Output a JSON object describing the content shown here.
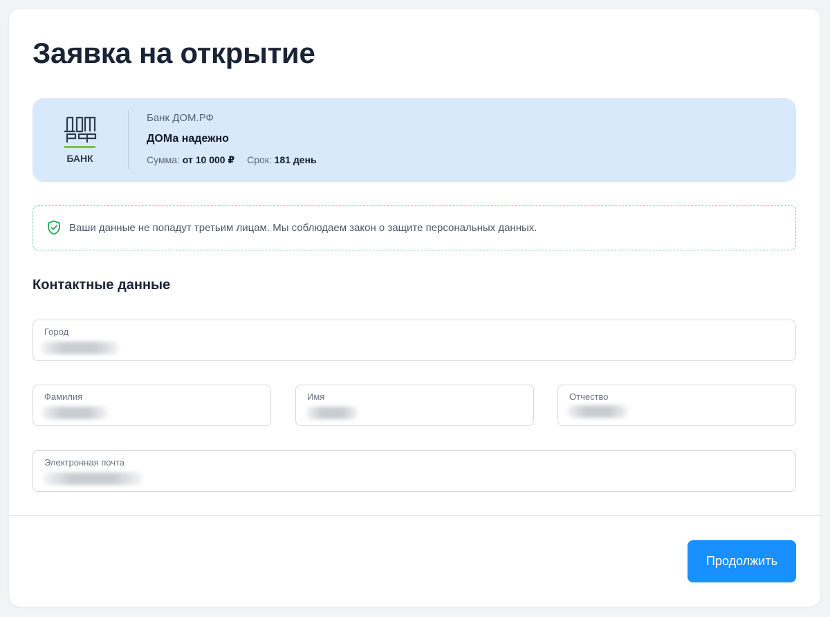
{
  "page": {
    "title": "Заявка на открытие"
  },
  "bank": {
    "logo_text": "БАНК",
    "name": "Банк ДОМ.РФ",
    "product": "ДОМа надежно",
    "amount_label": "Сумма:",
    "amount_value": "от 10 000 ₽",
    "term_label": "Срок:",
    "term_value": "181 день",
    "colors": {
      "panel": "#d8e9fb",
      "logo": "#2f3a4a",
      "logo_accent": "#7cc242"
    }
  },
  "privacy": {
    "icon": "shield-check-icon",
    "text": "Ваши данные не попадут третьим лицам. Мы соблюдаем закон о защите персональных данных."
  },
  "contacts": {
    "title": "Контактные данные",
    "fields": {
      "city": {
        "label": "Город"
      },
      "last_name": {
        "label": "Фамилия"
      },
      "first_name": {
        "label": "Имя"
      },
      "patronymic": {
        "label": "Отчество"
      },
      "email": {
        "label": "Электронная почта"
      }
    }
  },
  "actions": {
    "continue": "Продолжить",
    "accent": "#1890ff"
  }
}
